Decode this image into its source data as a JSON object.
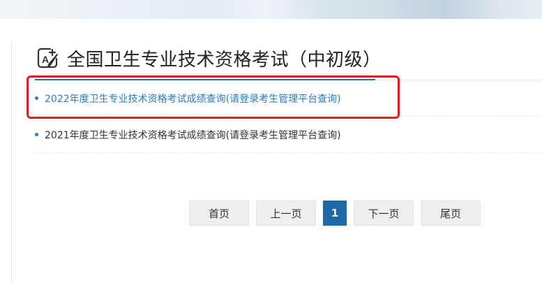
{
  "header": {
    "title": "全国卫生专业技术资格考试（中初级）",
    "icon": "font-edit-icon"
  },
  "articles": [
    {
      "text": "2022年度卫生专业技术资格考试成绩查询(请登录考生管理平台查询)",
      "highlighted": true
    },
    {
      "text": "2021年度卫生专业技术资格考试成绩查询(请登录考生管理平台查询)",
      "highlighted": false
    }
  ],
  "pagination": {
    "first": "首页",
    "prev": "上一页",
    "current": "1",
    "next": "下一页",
    "last": "尾页"
  },
  "colors": {
    "accent": "#1d6aa5",
    "link": "#2e7cc0",
    "highlight": "#e02020"
  }
}
